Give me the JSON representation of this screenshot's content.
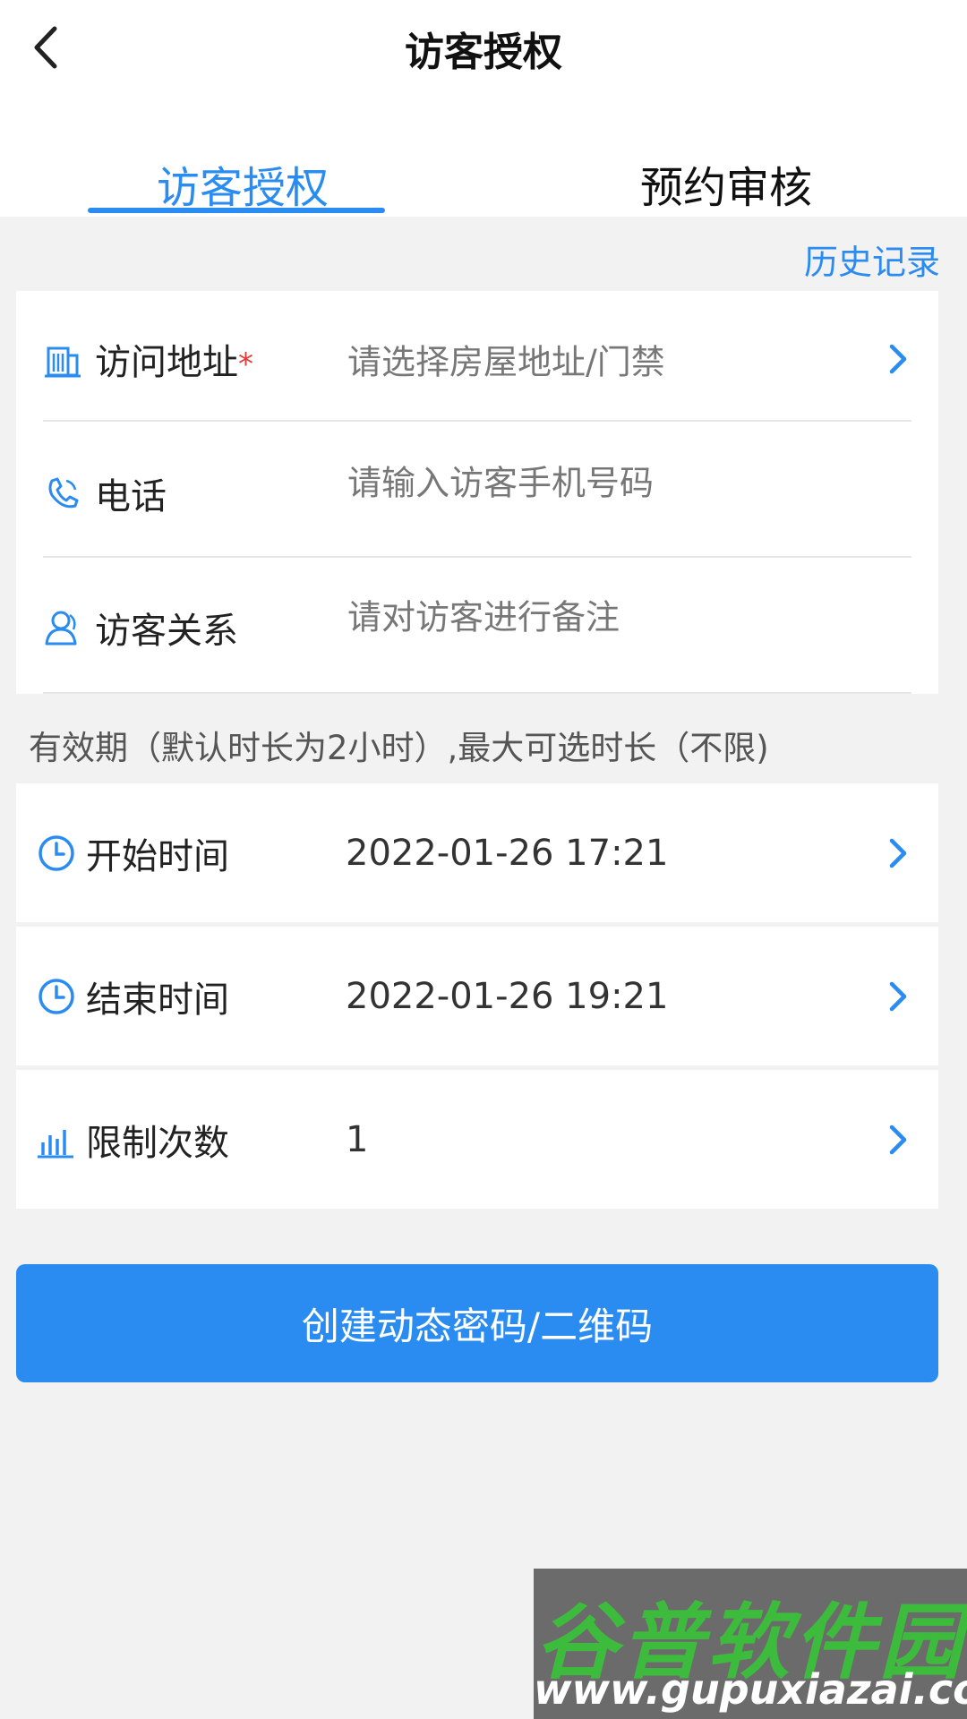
{
  "header": {
    "title": "访客授权",
    "back_icon": "chevron-left-icon"
  },
  "tabs": [
    {
      "label": "访客授权",
      "active": true
    },
    {
      "label": "预约审核",
      "active": false
    }
  ],
  "history_link": "历史记录",
  "form": {
    "address": {
      "label": "访问地址",
      "required_mark": "*",
      "placeholder": "请选择房屋地址/门禁",
      "icon": "building-icon"
    },
    "phone": {
      "label": "电话",
      "placeholder": "请输入访客手机号码",
      "icon": "phone-icon"
    },
    "relation": {
      "label": "访客关系",
      "placeholder": "请对访客进行备注",
      "icon": "user-icon"
    }
  },
  "validity_note": "有效期（默认时长为2小时）,最大可选时长（不限)",
  "time": {
    "start": {
      "label": "开始时间",
      "value": "2022-01-26 17:21",
      "icon": "clock-icon"
    },
    "end": {
      "label": "结束时间",
      "value": "2022-01-26 19:21",
      "icon": "clock-icon"
    },
    "limit": {
      "label": "限制次数",
      "value": "1",
      "icon": "bar-chart-icon"
    }
  },
  "create_button": "创建动态密码/二维码",
  "watermark": {
    "top_text": "谷普软件园",
    "bottom_text": "www.gupuxiazai.com"
  },
  "colors": {
    "accent": "#2a8cf0",
    "background": "#f2f2f2",
    "required": "#e53935"
  }
}
